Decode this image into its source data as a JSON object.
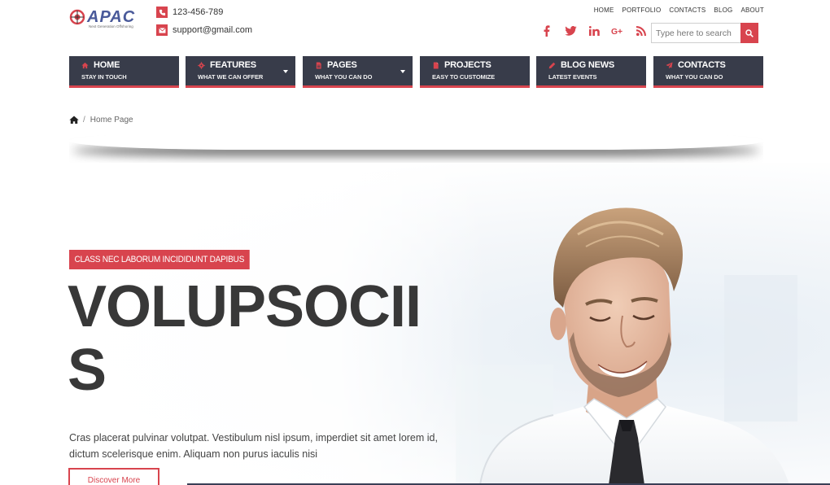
{
  "brand": {
    "logo_text": "APAC",
    "tagline": "Next Generation Offshoring",
    "accent": "#d8444e",
    "nav_bg": "#383c4a"
  },
  "contact": {
    "phone": "123-456-789",
    "email": "support@gmail.com"
  },
  "top_links": [
    "HOME",
    "PORTFOLIO",
    "CONTACTS",
    "BLOG",
    "ABOUT"
  ],
  "social_icons": [
    "facebook-icon",
    "twitter-icon",
    "linkedin-icon",
    "google-plus-icon",
    "rss-icon"
  ],
  "search": {
    "placeholder": "Type here to search"
  },
  "nav": [
    {
      "title": "HOME",
      "subtitle": "STAY IN TOUCH",
      "icon": "home-icon",
      "dropdown": false
    },
    {
      "title": "FEATURES",
      "subtitle": "WHAT WE CAN OFFER",
      "icon": "gear-icon",
      "dropdown": true
    },
    {
      "title": "PAGES",
      "subtitle": "WHAT YOU CAN DO",
      "icon": "document-icon",
      "dropdown": true
    },
    {
      "title": "PROJECTS",
      "subtitle": "EASY TO CUSTOMIZE",
      "icon": "file-icon",
      "dropdown": false
    },
    {
      "title": "BLOG NEWS",
      "subtitle": "LATEST EVENTS",
      "icon": "pencil-icon",
      "dropdown": false
    },
    {
      "title": "CONTACTS",
      "subtitle": "WHAT YOU CAN DO",
      "icon": "paper-plane-icon",
      "dropdown": false
    }
  ],
  "breadcrumb": {
    "separator": "/",
    "current": "Home Page"
  },
  "hero": {
    "tag": "CLASS NEC LABORUM INCIDIDUNT DAPIBUS",
    "title": "VOLUPSOCIIS",
    "text": "Cras placerat pulvinar volutpat. Vestibulum nisl ipsum, imperdiet sit amet lorem id, dictum scelerisque enim. Aliquam non purus iaculis nisi",
    "button": "Discover More"
  }
}
